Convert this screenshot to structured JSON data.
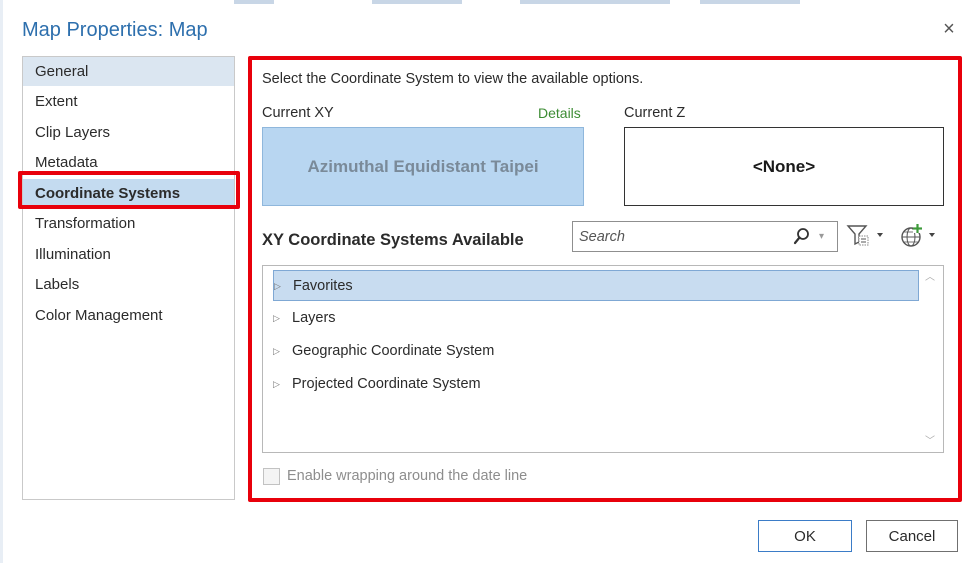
{
  "dialog": {
    "title": "Map Properties: Map",
    "close_label": "×"
  },
  "nav": {
    "items": [
      {
        "label": "General"
      },
      {
        "label": "Extent"
      },
      {
        "label": "Clip Layers"
      },
      {
        "label": "Metadata"
      },
      {
        "label": "Coordinate Systems"
      },
      {
        "label": "Transformation"
      },
      {
        "label": "Illumination"
      },
      {
        "label": "Labels"
      },
      {
        "label": "Color Management"
      }
    ],
    "selected": "Coordinate Systems"
  },
  "panel": {
    "hint": "Select the Coordinate System to view the available options.",
    "current_xy_label": "Current XY",
    "details_link": "Details",
    "current_z_label": "Current Z",
    "current_xy_value": "Azimuthal Equidistant Taipei",
    "current_z_value": "<None>",
    "available_title": "XY Coordinate Systems Available",
    "search_placeholder": "Search",
    "tree": [
      {
        "label": "Favorites",
        "selected": true
      },
      {
        "label": "Layers"
      },
      {
        "label": "Geographic Coordinate System"
      },
      {
        "label": "Projected Coordinate System"
      }
    ],
    "wrap_label": "Enable wrapping around the date line",
    "wrap_checked": false
  },
  "buttons": {
    "ok": "OK",
    "cancel": "Cancel"
  },
  "colors": {
    "title": "#2d6fad",
    "highlight": "#e8000b",
    "selected_bg": "#c4dbf0",
    "details": "#3d8c34"
  },
  "icons": {
    "search": "magnifier-icon",
    "filter": "filter-icon",
    "globe": "globe-add-icon",
    "expand": "triangle-right-icon"
  }
}
